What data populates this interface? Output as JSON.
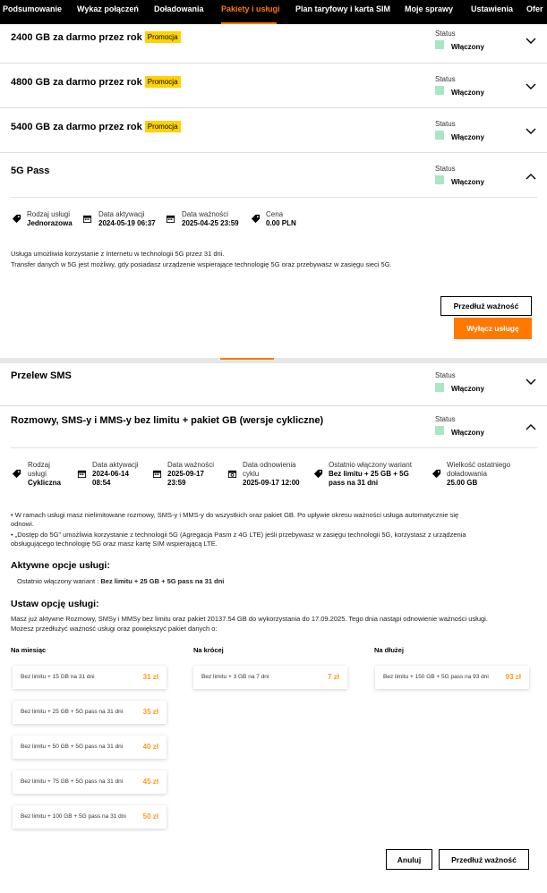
{
  "nav": {
    "items": [
      "Podsumowanie",
      "Wykaz połączeń",
      "Doładowania",
      "Pakiety i usługi",
      "Plan taryfowy i karta SIM",
      "Moje sprawy",
      "Ustawienia",
      "Ofer"
    ]
  },
  "status_label": "Status",
  "status_value": "Włączony",
  "promo_label": "Promocja",
  "cards": {
    "c1": {
      "title": "2400 GB za darmo przez rok"
    },
    "c2": {
      "title": "4800 GB za darmo przez rok"
    },
    "c3": {
      "title": "5400 GB za darmo przez rok"
    },
    "c4": {
      "title": "5G Pass"
    }
  },
  "pass": {
    "m1_label": "Rodzaj usługi",
    "m1_value": "Jednorazowa",
    "m2_label": "Data aktywacji",
    "m2_value": "2024-05-19 06:37",
    "m3_label": "Data ważności",
    "m3_value": "2025-04-25 23:59",
    "m4_label": "Cena",
    "m4_value": "0.00 PLN",
    "desc1": "Usługa umożliwia korzystanie z Internetu w technologii 5G przez 31 dni.",
    "desc2": "Transfer danych w 5G jest możliwy, gdy posiadasz urządzenie wspierające technologię 5G oraz przebywasz w zasięgu sieci 5G.",
    "extend_btn": "Przedłuż ważność",
    "disable_btn": "Wyłącz usługę"
  },
  "sms": {
    "title": "Przelew SMS"
  },
  "rozmowy": {
    "title": "Rozmowy, SMS-y i MMS-y bez limitu + pakiet GB (wersje cykliczne)",
    "m1_label1": "Rodzaj",
    "m1_label2": "usługi",
    "m1_value": "Cykliczna",
    "m2_label": "Data aktywacji",
    "m2_value1": "2024-06-14",
    "m2_value2": "08:54",
    "m3_label": "Data ważności",
    "m3_value1": "2025-09-17",
    "m3_value2": "23:59",
    "m4_label1": "Data odnowienia",
    "m4_label2": "cyklu",
    "m4_value": "2025-09-17 12:00",
    "m5_label": "Ostatnio włączony wariant",
    "m5_value1": "Bez limitu + 25 GB + 5G",
    "m5_value2": "pass na 31 dni",
    "m6_label1": "Wielkość ostatniego",
    "m6_label2": "doładowania",
    "m6_value": "25.00 GB",
    "bullet1a": "• W ramach usługi masz nielimitowane rozmowy, SMS-y i MMS-y do wszystkich oraz pakiet GB. Po upływie okresu ważności usługa automatycznie się",
    "bullet1b": "odnowi.",
    "bullet2a": "• „Dostęp do 5G” umożliwia korzystanie z technologii 5G (Agregacja Pasm z 4G LTE) jeśli przebywasz w zasięgu technologii 5G, korzystasz z urządzenia",
    "bullet2b": "obsługującego technologię 5G oraz masz kartę SIM wspierającą LTE.",
    "active_h": "Aktywne opcje usługi:",
    "active_prefix": "Ostatnio włączony wariant :",
    "active_value": "Bez limitu + 25 GB + 5G pass na 31 dni",
    "set_h": "Ustaw opcję usługi:",
    "set_desc1": "Masz już aktywne Rozmowy, SMSy i MMSy bez limitu oraz pakiet 20137.54 GB do wykorzystania do 17.09.2025. Tego dnia nastąpi odnowienie ważności usługi.",
    "set_desc2": "Możesz przedłużyć ważność usługi oraz powiększyć pakiet danych o:",
    "col1_h": "Na miesiąc",
    "col2_h": "Na krócej",
    "col3_h": "Na dłużej",
    "options_month": [
      {
        "label": "Bez limitu + 15 GB na 31 dni",
        "price": "31 zł"
      },
      {
        "label": "Bez limitu + 25 GB + 5G pass na 31 dni",
        "price": "35 zł"
      },
      {
        "label": "Bez limitu + 50 GB + 5G pass na 31 dni",
        "price": "40 zł"
      },
      {
        "label": "Bez limitu + 75 GB + 5G pass na 31 dni",
        "price": "45 zł"
      },
      {
        "label": "Bez limitu + 100 GB + 5G pass na 31 dni",
        "price": "50 zł"
      }
    ],
    "option_short": {
      "label": "Bez limitu + 3 GB na 7 dni",
      "price": "7 zł"
    },
    "option_long": {
      "label": "Bez limitu + 150 GB + 5G pass na 93 dni",
      "price": "93 zł"
    },
    "cancel_btn": "Anuluj",
    "extend_btn": "Przedłuż ważność"
  },
  "colors": {
    "accent": "#ff7900",
    "promo": "#ffd200",
    "status": "#a8e6c6"
  }
}
